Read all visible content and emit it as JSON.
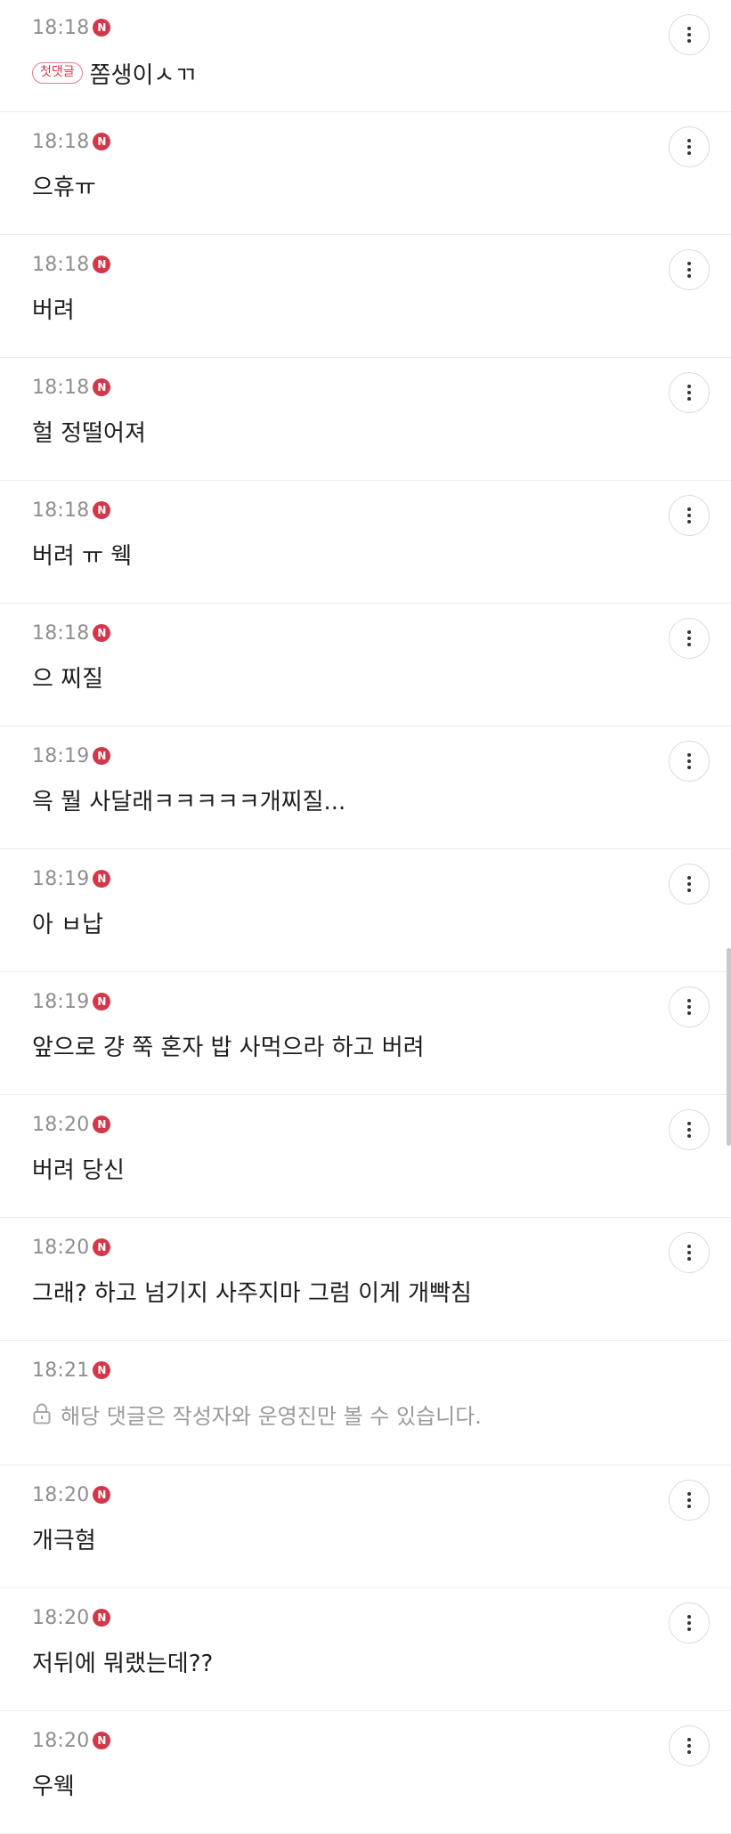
{
  "comments": [
    {
      "time": "18:18",
      "badge": "N",
      "tag": "첫댓글",
      "text": "쫌생이ㅅㄲ"
    },
    {
      "time": "18:18",
      "badge": "N",
      "text": "으휴ㅠ"
    },
    {
      "time": "18:18",
      "badge": "N",
      "text": "버려"
    },
    {
      "time": "18:18",
      "badge": "N",
      "text": "헐 정떨어져"
    },
    {
      "time": "18:18",
      "badge": "N",
      "text": "버려 ㅠ 웩"
    },
    {
      "time": "18:18",
      "badge": "N",
      "text": "으 찌질"
    },
    {
      "time": "18:19",
      "badge": "N",
      "text": "윽 뭘 사달래ㅋㅋㅋㅋㅋ개찌질..."
    },
    {
      "time": "18:19",
      "badge": "N",
      "text": "아 ㅂ납"
    },
    {
      "time": "18:19",
      "badge": "N",
      "text": "앞으로 걍 쭉 혼자 밥 사먹으라 하고 버려"
    },
    {
      "time": "18:20",
      "badge": "N",
      "text": "버려 당신"
    },
    {
      "time": "18:20",
      "badge": "N",
      "text": "그래? 하고 넘기지 사주지마 그럼 이게 개빡침"
    },
    {
      "time": "18:21",
      "badge": "N",
      "secret_text": "해당 댓글은 작성자와 운영진만 볼 수 있습니다."
    },
    {
      "time": "18:20",
      "badge": "N",
      "text": "개극혐"
    },
    {
      "time": "18:20",
      "badge": "N",
      "text": "저뒤에 뭐랬는데??"
    },
    {
      "time": "18:20",
      "badge": "N",
      "text": "우웩"
    }
  ],
  "icons": {
    "more": "more-vertical-icon",
    "lock": "lock-icon"
  },
  "colors": {
    "badge": "#d3384a",
    "time": "#8f8f8f",
    "text": "#1e1e1e",
    "secret": "#9a9a9a"
  }
}
